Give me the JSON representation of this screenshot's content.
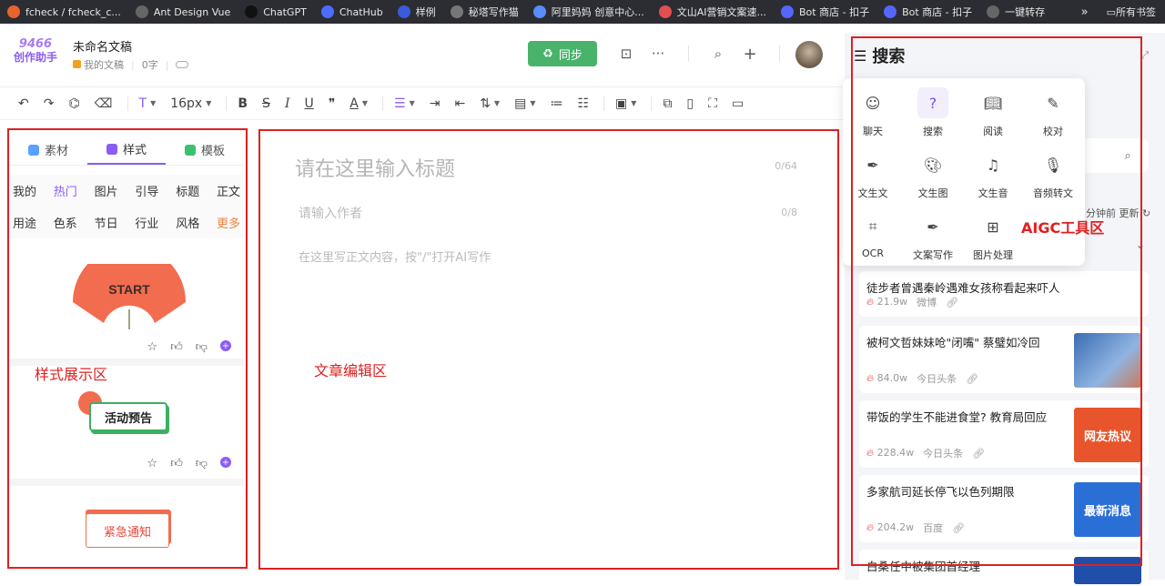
{
  "bookmarks": {
    "items": [
      {
        "label": "fcheck / fcheck_c...",
        "icon": "gitlab-icon",
        "color": "#e8642d"
      },
      {
        "label": "Ant Design Vue",
        "icon": "globe-icon",
        "color": "#666"
      },
      {
        "label": "ChatGPT",
        "icon": "openai-icon",
        "color": "#111"
      },
      {
        "label": "ChatHub",
        "icon": "chathub-icon",
        "color": "#4b6cff"
      },
      {
        "label": "样例",
        "icon": "folder-blue-icon",
        "color": "#3b5bdb"
      },
      {
        "label": "秘塔写作猫",
        "icon": "cat-icon",
        "color": "#777"
      },
      {
        "label": "阿里妈妈 创意中心...",
        "icon": "alimama-icon",
        "color": "#5b8cff"
      },
      {
        "label": "文山AI营销文案速...",
        "icon": "wenshan-icon",
        "color": "#e05050"
      },
      {
        "label": "Bot 商店 - 扣子",
        "icon": "bot-icon",
        "color": "#5566ff"
      },
      {
        "label": "Bot 商店 - 扣子",
        "icon": "bot-icon",
        "color": "#5566ff"
      },
      {
        "label": "一键转存",
        "icon": "globe-icon",
        "color": "#666"
      }
    ],
    "more": "»",
    "folder": "所有书签"
  },
  "app": {
    "logo_top": "9466",
    "logo_bottom": "创作助手",
    "doc_title": "未命名文稿",
    "folder": "我的文稿",
    "word_count": "0字",
    "sync_label": "同步"
  },
  "toolbar": {
    "font_size": "16px"
  },
  "left_panel": {
    "tabs": [
      {
        "label": "素材",
        "color": "#5aa0ff"
      },
      {
        "label": "样式",
        "color": "#8a5cf6"
      },
      {
        "label": "模板",
        "color": "#3cc070"
      }
    ],
    "cat_row1": [
      "我的",
      "热门",
      "图片",
      "引导",
      "标题",
      "正文"
    ],
    "cat_row2": [
      "用途",
      "色系",
      "节日",
      "行业",
      "风格",
      "更多"
    ],
    "cards": [
      {
        "text": "START"
      },
      {
        "text": "活动预告"
      },
      {
        "text": "紧急通知"
      }
    ]
  },
  "editor": {
    "title_placeholder": "请在这里输入标题",
    "title_count": "0/64",
    "author_placeholder": "请输入作者",
    "author_count": "0/8",
    "body_placeholder": "在这里写正文内容，按\"/\"打开AI写作"
  },
  "right_panel": {
    "title": "搜索",
    "tools": [
      {
        "label": "聊天",
        "icon": "smile-icon"
      },
      {
        "label": "搜索",
        "icon": "search-icon"
      },
      {
        "label": "阅读",
        "icon": "book-icon"
      },
      {
        "label": "校对",
        "icon": "proofread-icon"
      },
      {
        "label": "文生文",
        "icon": "pen-icon"
      },
      {
        "label": "文生图",
        "icon": "palette-icon"
      },
      {
        "label": "文生音",
        "icon": "text-audio-icon"
      },
      {
        "label": "音频转文",
        "icon": "mic-icon"
      },
      {
        "label": "OCR",
        "icon": "scan-icon"
      },
      {
        "label": "文案写作",
        "icon": "pen-icon"
      },
      {
        "label": "图片处理",
        "icon": "toolbox-icon"
      }
    ],
    "update_text": "分钟前 更新",
    "news": [
      {
        "title": "徒步者曾遇秦岭遇难女孩称看起来吓人",
        "heat": "21.9w",
        "source": "微博",
        "thumb": null
      },
      {
        "title": "被柯文哲妹妹呛\"闭嘴\" 蔡璧如冷回",
        "heat": "84.0w",
        "source": "今日头条",
        "thumb": "photo",
        "thumb_color": "#4a6fa5"
      },
      {
        "title": "带饭的学生不能进食堂? 教育局回应",
        "heat": "228.4w",
        "source": "今日头条",
        "thumb": "网友热议",
        "thumb_color": "#e8552c"
      },
      {
        "title": "多家航司延长停飞以色列期限",
        "heat": "204.2w",
        "source": "百度",
        "thumb": "最新消息",
        "thumb_color": "#2a6fd6"
      },
      {
        "title": "白桑任中被集团首经理",
        "heat": "",
        "source": "",
        "thumb": "",
        "thumb_color": "#1f4fa8"
      }
    ]
  },
  "annotations": {
    "style_area": "样式展示区",
    "editor_area": "文章编辑区",
    "aigc_area": "AIGC工具区",
    "color": "#e02020"
  }
}
